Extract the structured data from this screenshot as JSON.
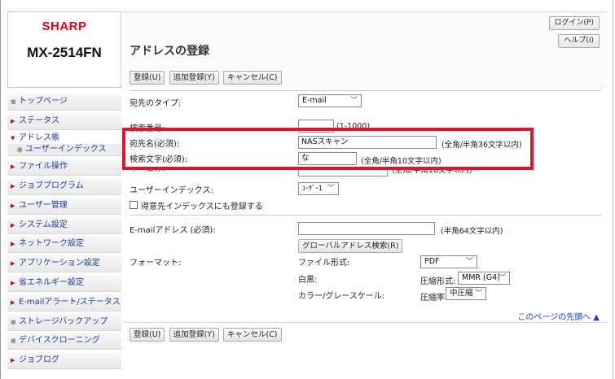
{
  "brand": {
    "logo_text": "SHARP",
    "model": "MX-2514FN"
  },
  "header": {
    "title": "アドレスの登録",
    "login_label": "ログイン(P)",
    "help_label": "ヘルプ(I)"
  },
  "actions": {
    "register": "登録(U)",
    "add_register": "追加登録(Y)",
    "cancel": "キャンセル(C)"
  },
  "sidebar": {
    "items": [
      {
        "label": "トップページ"
      },
      {
        "label": "ステータス"
      },
      {
        "label": "アドレス帳"
      },
      {
        "label": "ユーザーインデックス"
      },
      {
        "label": "ファイル操作"
      },
      {
        "label": "ジョブプログラム"
      },
      {
        "label": "ユーザー管理"
      },
      {
        "label": "システム設定"
      },
      {
        "label": "ネットワーク設定"
      },
      {
        "label": "アプリケーション設定"
      },
      {
        "label": "省エネルギー設定"
      },
      {
        "label": "E-mailアラート/ステータス"
      },
      {
        "label": "ストレージバックアップ"
      },
      {
        "label": "デバイスクローニング"
      },
      {
        "label": "ジョブログ"
      }
    ]
  },
  "form": {
    "dest_type_label": "宛先のタイプ:",
    "dest_type_value": "E-mail",
    "search_no_label": "検索番号:",
    "search_no_value": "",
    "search_no_hint": "(1-1000)",
    "dest_name_label": "宛先名(必須):",
    "dest_name_value": "NASスキャン",
    "dest_name_hint": "(全角/半角36文字以内)",
    "search_char_label": "検索文字(必須):",
    "search_char_value": "な",
    "search_char_hint": "(全角/半角10文字以内)",
    "group_label_partial": "キー名称:",
    "group_hint": "(全角/半角18文字以内)",
    "user_index_label": "ユーザーインデックス:",
    "user_index_value": "ﾕｰｻﾞｰ1",
    "favorite_label": "得意先インデックスにも登録する",
    "email_label": "E-mailアドレス (必須):",
    "email_value": "",
    "email_hint": "(半角64文字以内)",
    "global_search_button": "グローバルアドレス検索(R)",
    "format_label": "フォーマット:",
    "file_type_label": "ファイル形式:",
    "file_type_value": "PDF",
    "bw_label": "白黒:",
    "compression_format_label": "圧縮形式:",
    "compression_format_value": "MMR (G4)",
    "color_label": "カラー/グレースケール:",
    "compression_rate_label": "圧縮率:",
    "compression_rate_value": "中圧縮",
    "page_top_link": "このページの先頭へ ▲"
  },
  "colors": {
    "brand_red": "#e60012",
    "highlight_red": "#e8102a",
    "link_blue": "#1a3fd0"
  }
}
